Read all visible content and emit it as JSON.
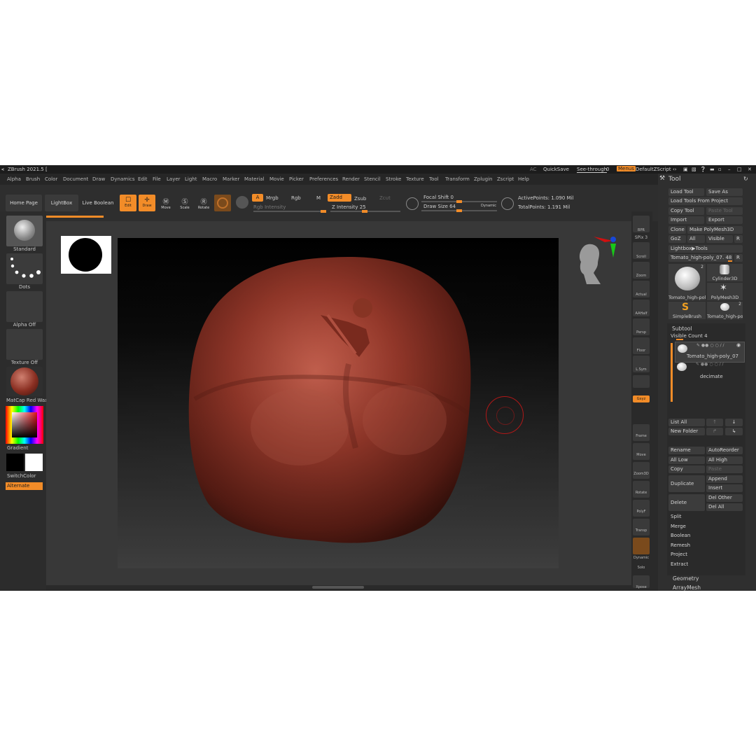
{
  "titlebar": {
    "app_title": "ZBrush 2021.5 [",
    "ac": "AC",
    "quicksave": "QuickSave",
    "see_through": "See-through",
    "see_through_value": "0",
    "menus": "Menus",
    "default_zscript": "DefaultZScript"
  },
  "menu": [
    "Alpha",
    "Brush",
    "Color",
    "Document",
    "Draw",
    "Dynamics",
    "Edit",
    "File",
    "Layer",
    "Light",
    "Macro",
    "Marker",
    "Material",
    "Movie",
    "Picker",
    "Preferences",
    "Render",
    "Stencil",
    "Stroke",
    "Texture",
    "Tool",
    "Transform",
    "Zplugin",
    "Zscript",
    "Help"
  ],
  "shelf": {
    "home_page": "Home Page",
    "lightbox": "LightBox",
    "live_boolean": "Live Boolean",
    "edit": "Edit",
    "draw": "Draw",
    "move": "Move",
    "scale": "Scale",
    "rotate": "Rotate",
    "a": "A",
    "mrgb": "Mrgb",
    "rgb": "Rgb",
    "m": "M",
    "rgb_intensity": "Rgb Intensity",
    "zadd": "Zadd",
    "zsub": "Zsub",
    "zcut": "Zcut",
    "z_intensity": "Z Intensity 25",
    "focal_shift": "Focal Shift 0",
    "draw_size": "Draw Size 64",
    "dynamic": "Dynamic",
    "active_points": "ActivePoints: 1.090 Mil",
    "total_points": "TotalPoints: 1.191 Mil"
  },
  "left_shelf": {
    "brush": "Standard",
    "stroke": "Dots",
    "alpha": "Alpha Off",
    "texture": "Texture Off",
    "material": "MatCap Red Wax",
    "gradient": "Gradient",
    "switch_color": "SwitchColor",
    "alternate": "Alternate"
  },
  "right_shelf": [
    {
      "name": "bpr",
      "label": "BPR"
    },
    {
      "name": "spix",
      "label": "SPix 3"
    },
    {
      "name": "scroll",
      "label": "Scroll"
    },
    {
      "name": "zoom",
      "label": "Zoom"
    },
    {
      "name": "actual",
      "label": "Actual"
    },
    {
      "name": "aahalf",
      "label": "AAHalf"
    },
    {
      "name": "persp",
      "label": "Persp"
    },
    {
      "name": "floor",
      "label": "Floor"
    },
    {
      "name": "lsym",
      "label": "L.Sym"
    },
    {
      "name": "lock",
      "label": ""
    },
    {
      "name": "xyz",
      "label": "Gxyz"
    },
    {
      "name": "frame",
      "label": "Frame"
    },
    {
      "name": "move",
      "label": "Move"
    },
    {
      "name": "zoom3d",
      "label": "Zoom3D"
    },
    {
      "name": "rotate",
      "label": "Rotate"
    },
    {
      "name": "polyf",
      "label": "PolyF"
    },
    {
      "name": "transp",
      "label": "Transp"
    },
    {
      "name": "dynamic",
      "label": "Dynamic"
    },
    {
      "name": "solo",
      "label": "Solo"
    },
    {
      "name": "xpose",
      "label": "Xpose"
    }
  ],
  "tool": {
    "title": "Tool",
    "load_tool": "Load Tool",
    "save_as": "Save As",
    "load_from_project": "Load Tools From Project",
    "copy_tool": "Copy Tool",
    "paste_tool": "Paste Tool",
    "import": "Import",
    "export": "Export",
    "clone": "Clone",
    "make_polymesh": "Make PolyMesh3D",
    "goz": "GoZ",
    "all": "All",
    "visible": "Visible",
    "r": "R",
    "lightbox_tools": "Lightbox▶Tools",
    "current_tool": "Tomato_high-poly_07. 48",
    "thumbs": [
      {
        "label": "Tomato_high-pol",
        "badge": "2"
      },
      {
        "label": "Cylinder3D",
        "badge": ""
      },
      {
        "label": "PolyMesh3D",
        "badge": ""
      },
      {
        "label": "SimpleBrush",
        "badge": ""
      },
      {
        "label": "Tomato_high-pol",
        "badge": "2"
      }
    ],
    "subtool": "Subtool",
    "visible_count": "Visible Count 4",
    "subtools": [
      "Tomato_high-poly_07",
      "decimate"
    ],
    "list_all": "List All",
    "new_folder": "New Folder",
    "rename": "Rename",
    "auto_reorder": "AutoReorder",
    "all_low": "All Low",
    "all_high": "All High",
    "copy": "Copy",
    "paste": "Paste",
    "duplicate": "Duplicate",
    "append": "Append",
    "insert": "Insert",
    "delete": "Delete",
    "del_other": "Del Other",
    "del_all": "Del All",
    "split": "Split",
    "merge": "Merge",
    "boolean": "Boolean",
    "remesh": "Remesh",
    "project": "Project",
    "extract": "Extract",
    "geometry": "Geometry",
    "arraymesh": "ArrayMesh"
  },
  "colors": {
    "accent": "#f28c28",
    "model": "#8a2f22",
    "background": "#2a2a2a"
  }
}
